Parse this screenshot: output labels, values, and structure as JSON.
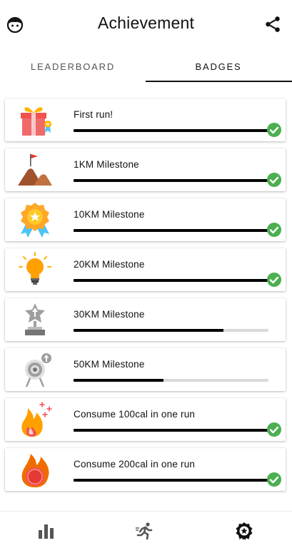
{
  "app_bar": {
    "title": "Achievement",
    "left_icon": "face-icon",
    "right_icon": "share-icon"
  },
  "tabs": [
    {
      "label": "LEADERBOARD",
      "selected": false
    },
    {
      "label": "BADGES",
      "selected": true
    }
  ],
  "badges": [
    {
      "label": "First run!",
      "icon": "gift-icon",
      "progress": 1.0,
      "completed": true
    },
    {
      "label": "1KM Milestone",
      "icon": "mountain-flag-icon",
      "progress": 1.0,
      "completed": true
    },
    {
      "label": "10KM Milestone",
      "icon": "medal-icon",
      "progress": 1.0,
      "completed": true
    },
    {
      "label": "20KM Milestone",
      "icon": "lightbulb-icon",
      "progress": 1.0,
      "completed": true
    },
    {
      "label": "30KM Milestone",
      "icon": "trophy-star-icon",
      "progress": 0.77,
      "completed": false
    },
    {
      "label": "50KM Milestone",
      "icon": "target-icon",
      "progress": 0.46,
      "completed": false
    },
    {
      "label": "Consume 100cal in one run",
      "icon": "fire-icon",
      "progress": 1.0,
      "completed": true
    },
    {
      "label": "Consume 200cal in one run",
      "icon": "kcal-flame-icon",
      "progress": 1.0,
      "completed": true
    }
  ],
  "bottom_nav": [
    {
      "icon": "bar-chart-icon"
    },
    {
      "icon": "runner-icon"
    },
    {
      "icon": "badge-award-icon",
      "selected": true
    }
  ],
  "colors": {
    "check_green": "#4CAF50",
    "progress_fill": "#000000",
    "progress_track": "#D9D9D9"
  }
}
